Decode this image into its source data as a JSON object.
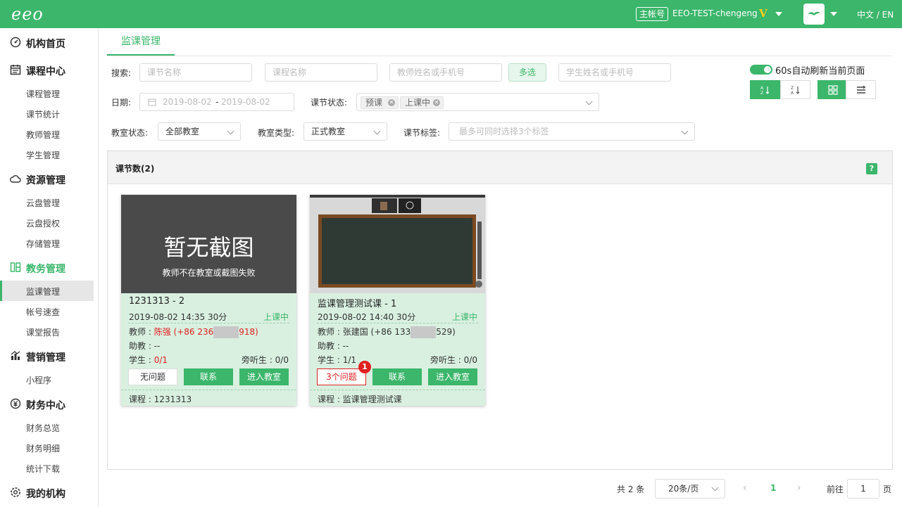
{
  "topbar": {
    "logo": "eeo",
    "account_badge": "主帐号",
    "account_name": "EEO-TEST-chengeng",
    "vip_mark": "V",
    "language": "中文 / EN"
  },
  "sidebar": {
    "groups": [
      {
        "label": "机构首页",
        "icon": "dashboard-icon"
      },
      {
        "label": "课程中心",
        "icon": "calendar-icon",
        "items": [
          "课程管理",
          "课节统计",
          "教师管理",
          "学生管理"
        ]
      },
      {
        "label": "资源管理",
        "icon": "cloud-icon",
        "items": [
          "云盘管理",
          "云盘授权",
          "存储管理"
        ]
      },
      {
        "label": "教务管理",
        "icon": "teaching-icon",
        "items": [
          "监课管理",
          "帐号速查",
          "课堂报告"
        ]
      },
      {
        "label": "营销管理",
        "icon": "chart-icon",
        "items": [
          "小程序"
        ]
      },
      {
        "label": "财务中心",
        "icon": "yen-icon",
        "items": [
          "财务总览",
          "财务明细",
          "统计下载"
        ]
      },
      {
        "label": "我的机构",
        "icon": "settings-icon"
      }
    ],
    "active_item": "监课管理"
  },
  "tab": {
    "label": "监课管理"
  },
  "filters": {
    "search_label": "搜索:",
    "lesson_placeholder": "课节名称",
    "course_placeholder": "课程名称",
    "teacher_placeholder": "教师姓名或手机号",
    "multi_select": "多选",
    "student_placeholder": "学生姓名或手机号",
    "date_label": "日期:",
    "date_start": "2019-08-02",
    "date_sep": "-",
    "date_end": "2019-08-02",
    "status_label": "课节状态:",
    "status_tags": [
      "预课",
      "上课中"
    ],
    "room_status_label": "教室状态:",
    "room_status_value": "全部教室",
    "room_type_label": "教室类型:",
    "room_type_value": "正式教室",
    "tag_label": "课节标签:",
    "tag_placeholder": "最多可同时选择3个标签"
  },
  "auto_refresh": {
    "label": "60s自动刷新当前页面",
    "enabled": true
  },
  "panel": {
    "title": "课节数(2)",
    "help": "?"
  },
  "cards": [
    {
      "no_screenshot_title": "暂无截图",
      "no_screenshot_sub": "教师不在教室或截图失败",
      "title": "1231313 - 2",
      "datetime": "2019-08-02 14:35 30分",
      "status": "上课中",
      "teacher_label": "教师 : ",
      "teacher_name": "陈强",
      "phone_prefix": "(+86 236",
      "phone_suffix": "918)",
      "assistant": "助教 :  --",
      "student_label": "学生 : ",
      "student_count": "0/1",
      "auditor": "旁听生 : 0/0",
      "issue_button": "无问题",
      "contact_button": "联系",
      "enter_button": "进入教室",
      "course": "课程 : 1231313"
    },
    {
      "title": "监课管理测试课 - 1",
      "datetime": "2019-08-02 14:40 30分",
      "status": "上课中",
      "teacher_label": "教师 : ",
      "teacher_name": "张建国",
      "phone_prefix": "(+86 133",
      "phone_suffix": "529)",
      "assistant": "助教 :  --",
      "student_label": "学生 : ",
      "student_count": "1/1",
      "auditor": "旁听生 : 0/0",
      "issue_button": "3个问题",
      "issue_badge": "1",
      "contact_button": "联系",
      "enter_button": "进入教室",
      "course": "课程 : 监课管理测试课"
    }
  ],
  "pagination": {
    "total": "共 2 条",
    "page_size": "20条/页",
    "current_page": "1",
    "goto_label": "前往",
    "goto_value": "1",
    "page_unit": "页"
  },
  "colors": {
    "brand": "#3bb66b",
    "danger": "#e02020"
  }
}
